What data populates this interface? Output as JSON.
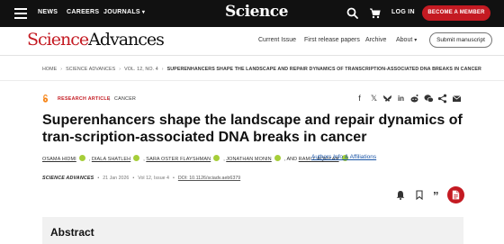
{
  "topbar": {
    "nav": [
      "NEWS",
      "CAREERS",
      "JOURNALS"
    ],
    "brand": "Science",
    "login": "LOG IN",
    "become_member": "BECOME A MEMBER"
  },
  "journal_header": {
    "logo_part1": "Science",
    "logo_part2": "Advances",
    "nav": {
      "current_issue": "Current Issue",
      "first_release": "First release papers",
      "archive": "Archive",
      "about": "About"
    },
    "submit": "Submit manuscript"
  },
  "breadcrumb": {
    "home": "HOME",
    "journal": "SCIENCE ADVANCES",
    "issue": "VOL. 12, NO. 4",
    "current": "SUPERENHANCERS SHAPE THE LANDSCAPE AND REPAIR DYNAMICS OF TRANSCRIPTION-ASSOCIATED DNA BREAKS IN CANCER"
  },
  "article": {
    "type": "RESEARCH ARTICLE",
    "subject": "CANCER",
    "title": "Superenhancers shape the landscape and repair dynamics of tran-scription-associated DNA breaks in cancer",
    "authors": {
      "a1": "OSAMA HIDMI",
      "a2": "DIALA SHATLEH",
      "a3": "SARA OSTER FLAYSHMAN",
      "a4": "JONATHAN MONIN",
      "and_text": "AND",
      "a5": "RAMI I. AQEILAN"
    },
    "affiliations_link": "Authors Info & Affiliations",
    "citation": {
      "journal": "SCIENCE ADVANCES",
      "date": "21 Jan 2026",
      "volume": "Vol 12, Issue 4",
      "doi": "DOI: 10.1126/sciadv.aeb6379"
    }
  },
  "abstract": {
    "heading": "Abstract"
  },
  "colors": {
    "brand_red": "#c41a22",
    "orcid_green": "#a6ce39",
    "link_blue": "#1a55a6"
  }
}
